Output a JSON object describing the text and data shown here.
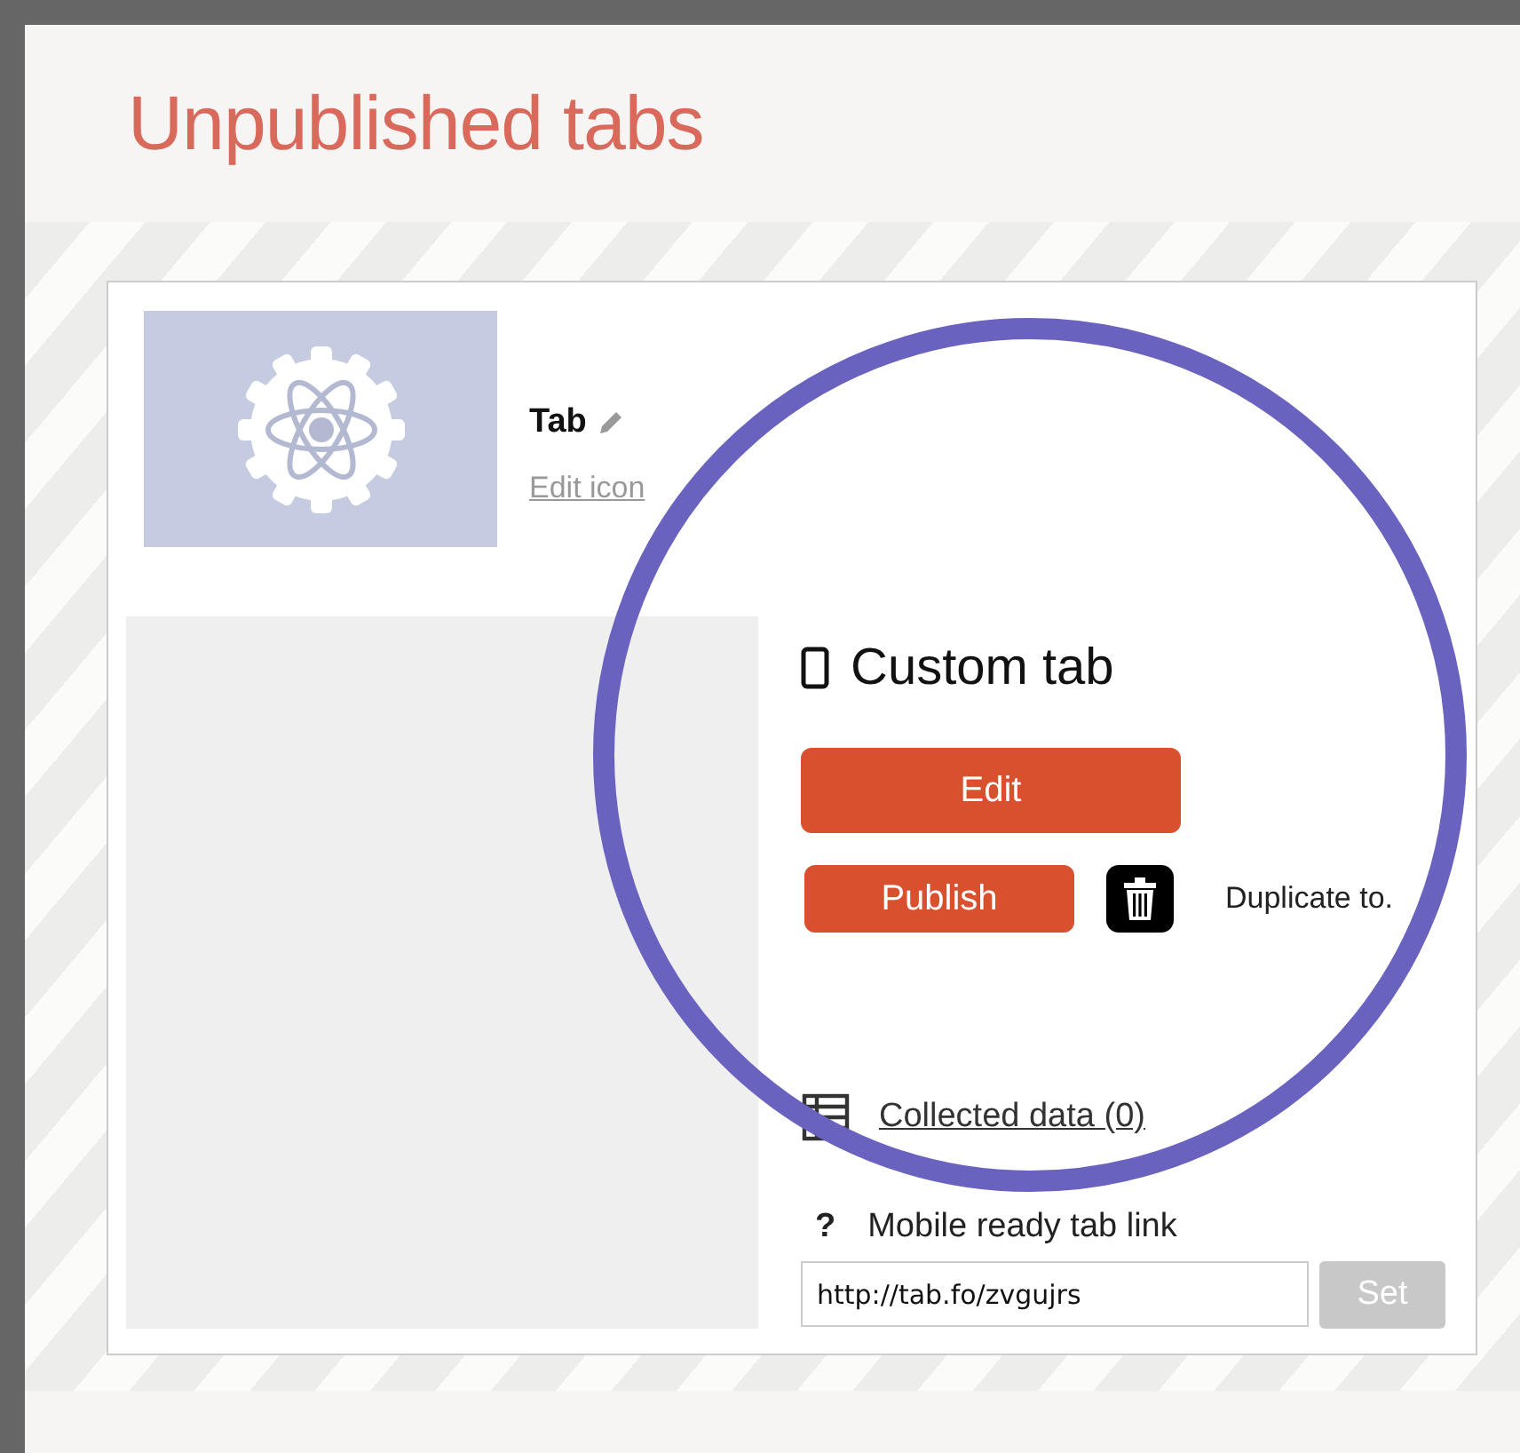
{
  "page_title": "Unpublished tabs",
  "tab_card": {
    "name": "Tab",
    "edit_icon_link": "Edit icon",
    "type_label": "Custom tab",
    "edit_button": "Edit",
    "publish_button": "Publish",
    "duplicate_link": "Duplicate to.",
    "collected_data_link": "Collected data (0)",
    "help_mark": "?",
    "mobile_link_label": "Mobile ready tab link",
    "mobile_link_value": "http://tab.fo/zvgujrs",
    "set_button": "Set",
    "set_disabled": true
  }
}
